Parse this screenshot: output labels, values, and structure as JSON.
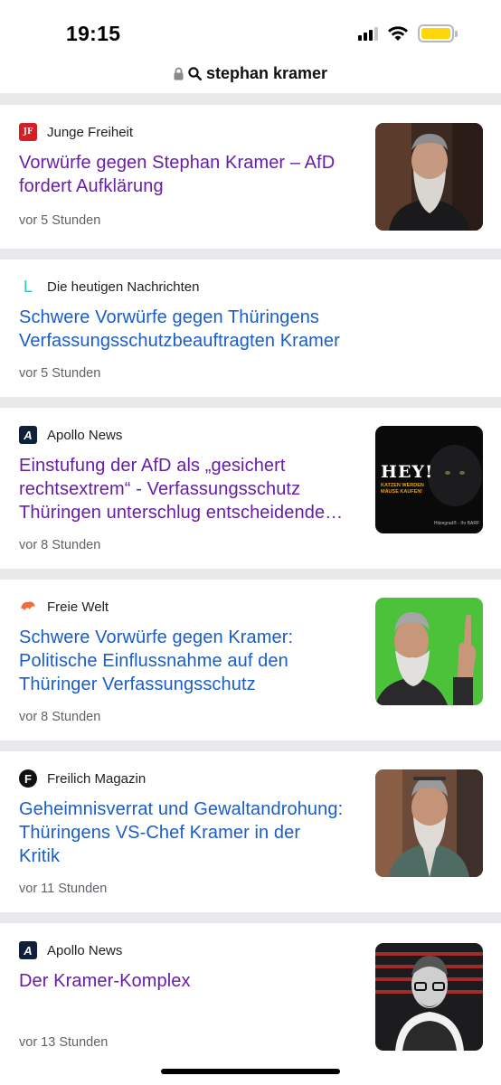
{
  "status": {
    "time": "19:15"
  },
  "url_bar": {
    "query": "stephan kramer",
    "icons": [
      "lock-icon",
      "search-icon"
    ]
  },
  "articles": [
    {
      "source": "Junge Freiheit",
      "logo_text": "JF",
      "logo_color": "#d32027",
      "headline_lines": [
        "Vorwürfe gegen Stephan Kramer – AfD",
        "fordert Aufklärung"
      ],
      "visited": true,
      "time": "vor 5 Stunden",
      "thumbnail": "portrait-bearded-man"
    },
    {
      "source": "Die heutigen Nachrichten",
      "logo_text": "L",
      "logo_color": "#2bc4c4",
      "headline_lines": [
        "Schwere Vorwürfe gegen Thüringens",
        "Verfassungsschutzbeauftragten Kramer"
      ],
      "visited": false,
      "time": "vor 5 Stunden",
      "thumbnail": null
    },
    {
      "source": "Apollo News",
      "logo_text": "A",
      "logo_color": "#10203a",
      "headline_lines": [
        "Einstufung der AfD als „gesichert",
        "rechtsextrem“ - Verfassungsschutz",
        "Thüringen unterschlug entscheidende…"
      ],
      "visited": true,
      "time": "vor 8 Stunden",
      "thumbnail": "hey-poster",
      "thumb_text": {
        "title": "HEY!",
        "sub1": "KATZEN WERDEN",
        "sub2": "MÄUSE KAUFEN!",
        "credit": "Hitzegrad® - Ihr BARF"
      }
    },
    {
      "source": "Freie Welt",
      "logo_text": "",
      "logo_color": "#f26b3a",
      "headline_lines": [
        "Schwere Vorwürfe gegen Kramer:",
        "Politische Einflussnahme auf den",
        "Thüringer Verfassungsschutz"
      ],
      "visited": false,
      "time": "vor 8 Stunden",
      "thumbnail": "green-screen-man"
    },
    {
      "source": "Freilich Magazin",
      "logo_text": "F",
      "logo_color": "#111111",
      "headline_lines": [
        "Geheimnisverrat und Gewaltandrohung:",
        "Thüringens VS-Chef Kramer in der",
        "Kritik"
      ],
      "visited": false,
      "time": "vor 11 Stunden",
      "thumbnail": "street-portrait"
    },
    {
      "source": "Apollo News",
      "logo_text": "A",
      "logo_color": "#10203a",
      "headline_lines": [
        "Der Kramer-Komplex"
      ],
      "visited": true,
      "time": "vor 13 Stunden",
      "thumbnail": "bw-collage"
    }
  ]
}
